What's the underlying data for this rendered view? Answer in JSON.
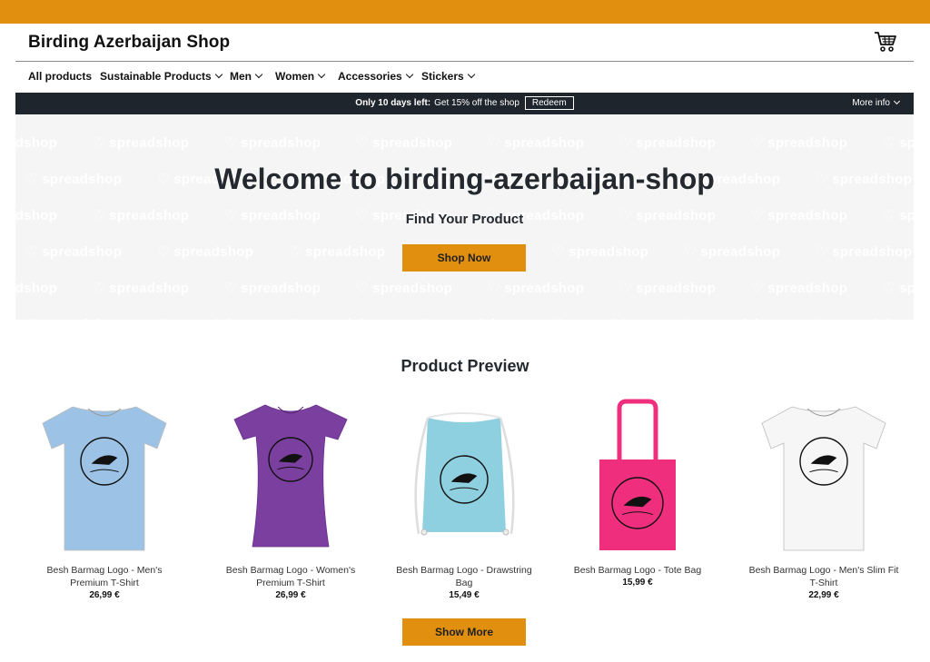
{
  "header": {
    "shop_title": "Birding Azerbaijan Shop",
    "cart_icon": "shopping-cart-icon"
  },
  "nav": {
    "items": [
      {
        "label": "All products",
        "has_dropdown": false
      },
      {
        "label": "Sustainable Products",
        "has_dropdown": true
      },
      {
        "label": "Men",
        "has_dropdown": true
      },
      {
        "label": "Women",
        "has_dropdown": true
      },
      {
        "label": "Accessories",
        "has_dropdown": true
      },
      {
        "label": "Stickers",
        "has_dropdown": true
      }
    ]
  },
  "promo": {
    "bold_text": "Only 10 days left:",
    "text": "Get 15% off the shop",
    "redeem_label": "Redeem",
    "more_info_label": "More info"
  },
  "hero": {
    "pattern_text": "spreadshop",
    "title": "Welcome to birding-azerbaijan-shop",
    "subtitle": "Find Your Product",
    "cta_label": "Shop Now"
  },
  "preview": {
    "title": "Product Preview",
    "products": [
      {
        "name": "Besh Barmag Logo - Men's Premium T-Shirt",
        "price": "26,99 €",
        "color": "#9cc3e6",
        "kind": "tshirt"
      },
      {
        "name": "Besh Barmag Logo - Women's Premium T-Shirt",
        "price": "26,99 €",
        "color": "#7b3fa0",
        "kind": "womens-tshirt"
      },
      {
        "name": "Besh Barmag Logo - Drawstring Bag",
        "price": "15,49 €",
        "color": "#8fd0e0",
        "kind": "drawstring-bag"
      },
      {
        "name": "Besh Barmag Logo - Tote Bag",
        "price": "15,99 €",
        "color": "#ef2f7e",
        "kind": "tote-bag"
      },
      {
        "name": "Besh Barmag Logo - Men's Slim Fit T-Shirt",
        "price": "22,99 €",
        "color": "#f6f6f6",
        "kind": "tshirt"
      }
    ],
    "show_more_label": "Show More"
  },
  "colors": {
    "accent": "#e08f0f",
    "promo_bg": "#1f252c",
    "hero_bg": "#f5f5f5"
  }
}
